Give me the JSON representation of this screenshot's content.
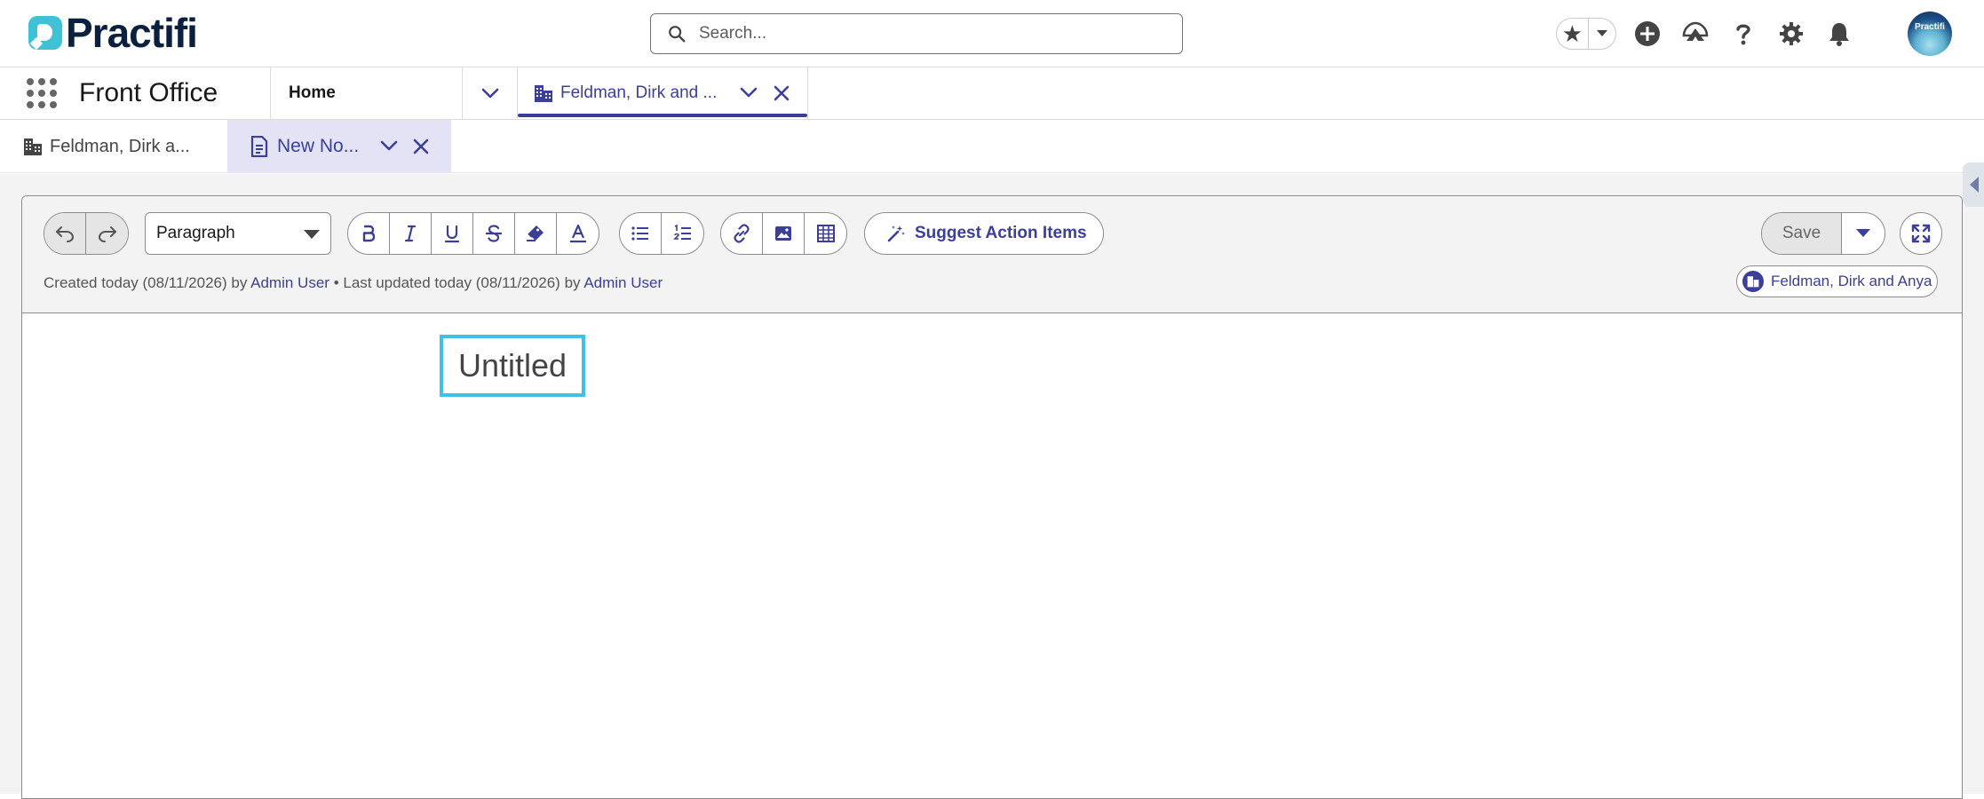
{
  "header": {
    "logo_text": "Practifi",
    "search_placeholder": "Search...",
    "avatar_text": "Practifi"
  },
  "nav": {
    "app_name": "Front Office",
    "home_label": "Home",
    "active_tab_label": "Feldman, Dirk and ..."
  },
  "subtabs": {
    "record_tab_label": "Feldman, Dirk a...",
    "note_tab_label": "New No..."
  },
  "editor": {
    "format_select": "Paragraph",
    "suggest_label": "Suggest Action Items",
    "save_label": "Save",
    "meta": {
      "created_prefix": "Created today (08/11/2026) by",
      "created_by": "Admin User",
      "updated_prefix": "• Last updated today (08/11/2026) by",
      "updated_by": "Admin User"
    },
    "related_record": "Feldman, Dirk and Anya",
    "note_title": "Untitled"
  },
  "colors": {
    "brand_dark": "#0b1f3f",
    "brand_teal": "#3fc1d6",
    "accent": "#3b3f97",
    "focus_border": "#3fc1e6"
  }
}
